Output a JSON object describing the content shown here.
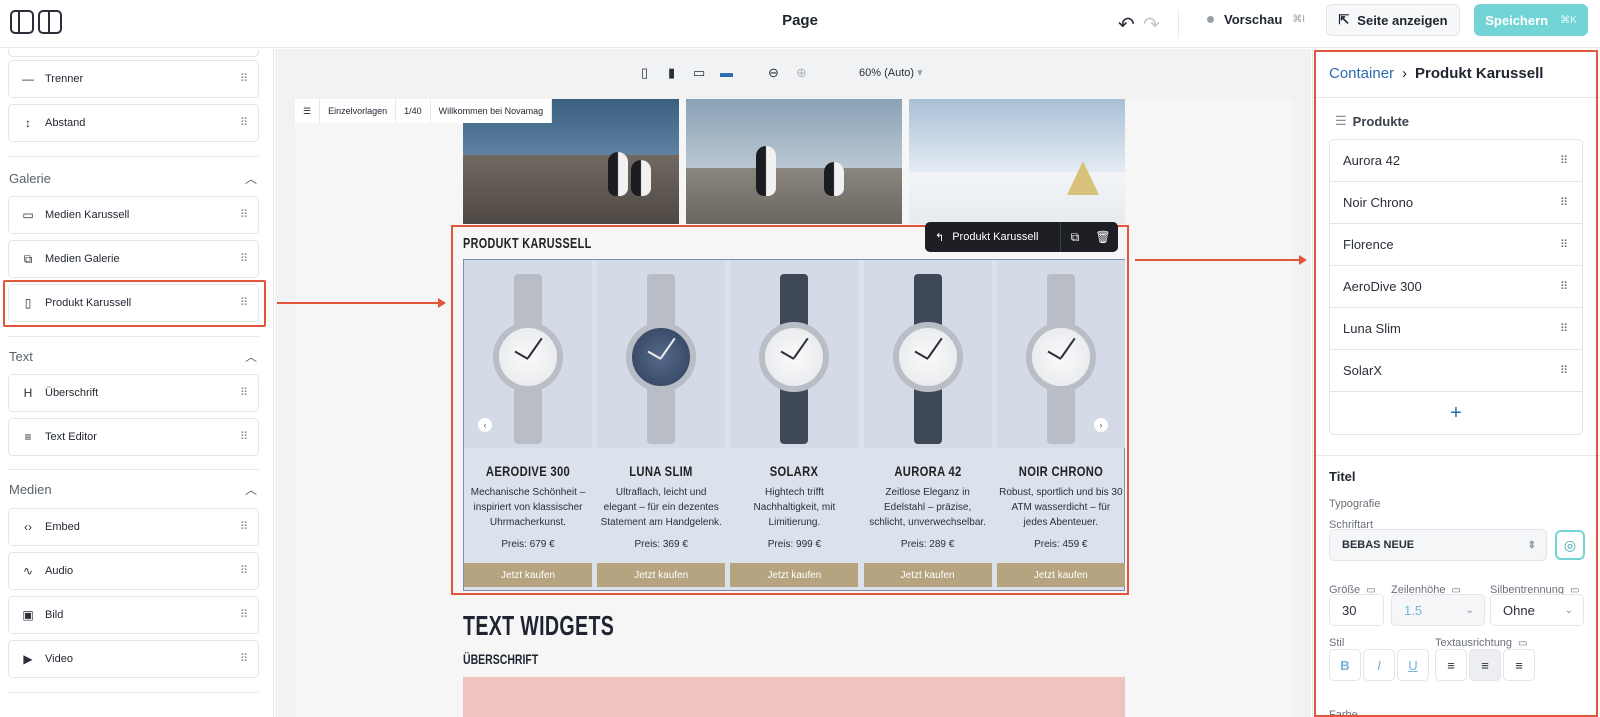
{
  "header": {
    "title": "Page",
    "preview_label": "Vorschau",
    "preview_kbd": "⌘I",
    "show_site_label": "Seite anzeigen",
    "save_label": "Speichern",
    "save_kbd": "⌘K"
  },
  "sidebar": {
    "top_items": [
      {
        "label": "Trenner",
        "icon": "divider-icon"
      },
      {
        "label": "Abstand",
        "icon": "spacer-icon"
      }
    ],
    "sections": [
      {
        "title": "Galerie",
        "items": [
          {
            "label": "Medien Karussell",
            "icon": "media-carousel-icon"
          },
          {
            "label": "Medien Galerie",
            "icon": "media-gallery-icon"
          },
          {
            "label": "Produkt Karussell",
            "icon": "product-carousel-icon"
          }
        ]
      },
      {
        "title": "Text",
        "items": [
          {
            "label": "Überschrift",
            "icon": "heading-icon"
          },
          {
            "label": "Text Editor",
            "icon": "text-editor-icon"
          }
        ]
      },
      {
        "title": "Medien",
        "items": [
          {
            "label": "Embed",
            "icon": "embed-icon"
          },
          {
            "label": "Audio",
            "icon": "audio-icon"
          },
          {
            "label": "Bild",
            "icon": "image-icon"
          },
          {
            "label": "Video",
            "icon": "video-icon"
          }
        ]
      }
    ]
  },
  "canvas": {
    "zoom_label": "60% (Auto)",
    "page_tabs": [
      "Einzelvorlagen",
      "1/40",
      "Willkommen bei Novamag"
    ],
    "product_section_title": "PRODUKT KARUSSELL",
    "selected_widget_label": "Produkt Karussell",
    "products": [
      {
        "name": "AERODIVE 300",
        "desc": "Mechanische Schönheit – inspiriert von klassischer Uhrmacherkunst.",
        "price": "Preis: 679 €",
        "button": "Jetzt kaufen",
        "strap": "#b9bec6"
      },
      {
        "name": "LUNA SLIM",
        "desc": "Ultraflach, leicht und elegant – für ein dezentes Statement am Handgelenk.",
        "price": "Preis: 369 €",
        "button": "Jetzt kaufen",
        "strap": "#b9bec6"
      },
      {
        "name": "SOLARX",
        "desc": "Hightech trifft Nachhaltigkeit, mit Limitierung.",
        "price": "Preis: 999 €",
        "button": "Jetzt kaufen",
        "strap": "#3e4856"
      },
      {
        "name": "AURORA 42",
        "desc": "Zeitlose Eleganz in Edelstahl – präzise, schlicht, unverwechselbar.",
        "price": "Preis: 289 €",
        "button": "Jetzt kaufen",
        "strap": "#3e4856"
      },
      {
        "name": "NOIR CHRONO",
        "desc": "Robust, sportlich und bis 30 ATM wasserdicht – für jedes Abenteuer.",
        "price": "Preis: 459 €",
        "button": "Jetzt kaufen",
        "strap": "#b9bec6"
      }
    ],
    "text_widgets_title": "TEXT WIDGETS",
    "heading_label": "ÜBERSCHRIFT"
  },
  "panel": {
    "breadcrumb_parent": "Container",
    "breadcrumb_current": "Produkt Karussell",
    "products_label": "Produkte",
    "product_list": [
      "Aurora 42",
      "Noir Chrono",
      "Florence",
      "AeroDive 300",
      "Luna Slim",
      "SolarX"
    ],
    "title_section": "Titel",
    "typography_label": "Typografie",
    "font_label": "Schriftart",
    "font_value": "BEBAS NEUE",
    "size_label": "Größe",
    "size_value": "30",
    "lineheight_label": "Zeilenhöhe",
    "lineheight_value": "1.5",
    "hyphen_label": "Silbentrennung",
    "hyphen_value": "Ohne",
    "style_label": "Stil",
    "align_label": "Textausrichtung",
    "color_label": "Farbe"
  },
  "colors": {
    "accent": "#73d4d6",
    "highlight": "#e0553b",
    "buy_button": "#b6a37f",
    "link": "#2b6cb0"
  }
}
